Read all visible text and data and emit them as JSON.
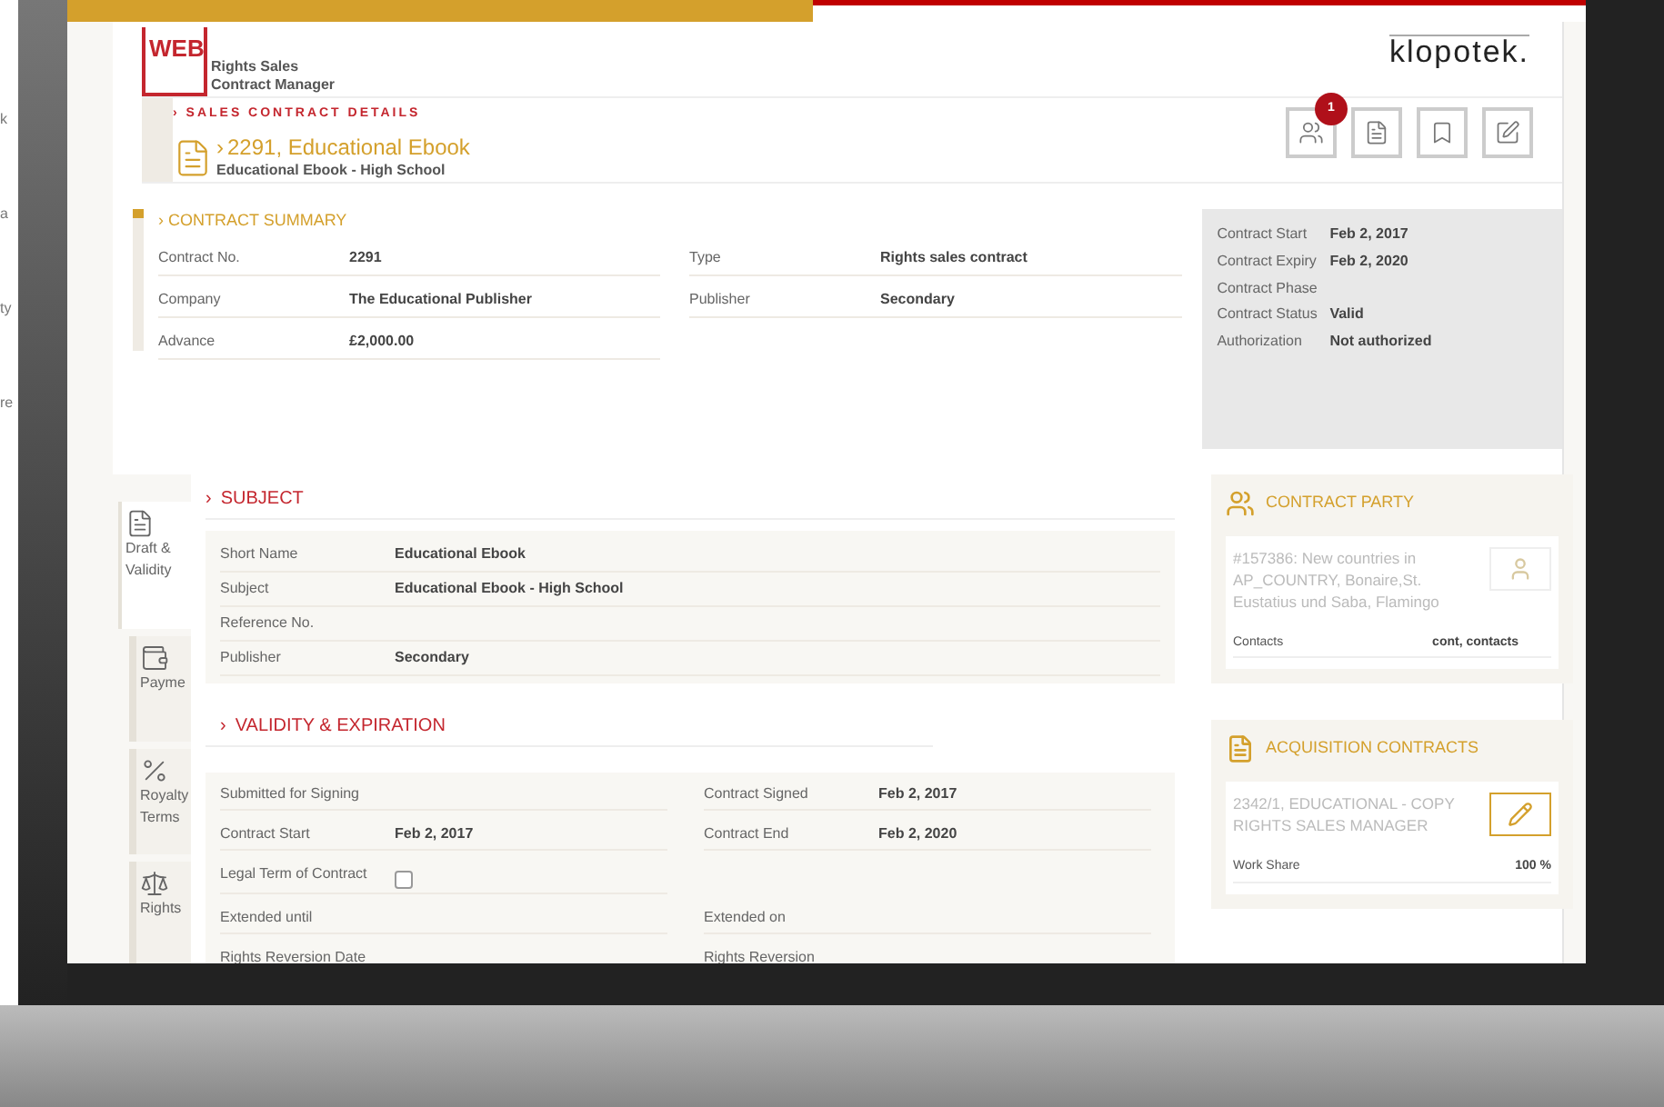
{
  "background_window": {
    "fragments": [
      "k",
      "a",
      "ty",
      "re"
    ]
  },
  "header": {
    "logo_mark": "WEB",
    "logo_lines": [
      "Rights Sales",
      "Contract Manager"
    ],
    "brand": "klopotek."
  },
  "details": {
    "section_label": "› SALES CONTRACT DETAILS",
    "chevron": "›",
    "title": "2291, Educational Ebook",
    "subtitle": "Educational Ebook - High School",
    "toolbar": [
      {
        "kind": "people",
        "badge": "1"
      },
      {
        "kind": "sign"
      },
      {
        "kind": "bookmark"
      },
      {
        "kind": "edit"
      }
    ]
  },
  "summary": {
    "heading": "› CONTRACT SUMMARY",
    "left": [
      {
        "label": "Contract No.",
        "value": "2291"
      },
      {
        "label": "Company",
        "value": "The Educational Publisher"
      },
      {
        "label": "Advance",
        "value": "£2,000.00"
      }
    ],
    "right": [
      {
        "label": "Type",
        "value": "Rights sales contract"
      },
      {
        "label": "Publisher",
        "value": "Secondary"
      }
    ]
  },
  "status_panel": [
    {
      "label": "Contract Start",
      "value": "Feb 2, 2017"
    },
    {
      "label": "Contract Expiry",
      "value": "Feb 2, 2020"
    },
    {
      "label": "Contract Phase"
    },
    {
      "label": "Contract Status",
      "value": "Valid"
    },
    {
      "label": "Authorization",
      "value": "Not authorized"
    }
  ],
  "tabs": [
    {
      "kind": "draft",
      "label": "Draft & Validity",
      "selected": true
    },
    {
      "kind": "payment",
      "label": "Payme",
      "selected": false
    },
    {
      "kind": "royalty",
      "label": "Royalty Terms",
      "selected": false
    },
    {
      "kind": "rights",
      "label": "Rights",
      "selected": false
    }
  ],
  "subject": {
    "heading": "SUBJECT",
    "chevron": "›",
    "fields": [
      {
        "label": "Short Name",
        "value": "Educational Ebook"
      },
      {
        "label": "Subject",
        "value": "Educational Ebook - High School"
      },
      {
        "label": "Reference No."
      },
      {
        "label": "Publisher",
        "value": "Secondary"
      }
    ]
  },
  "validity": {
    "heading": "VALIDITY & EXPIRATION",
    "chevron": "›",
    "rows": [
      [
        {
          "kind": "text",
          "label": "Submitted for Signing"
        },
        {
          "kind": "text",
          "label": "Contract Signed",
          "value": "Feb 2, 2017"
        }
      ],
      [
        {
          "kind": "text",
          "label": "Contract Start",
          "value": "Feb 2, 2017"
        },
        {
          "kind": "text",
          "label": "Contract End",
          "value": "Feb 2, 2020"
        }
      ],
      [
        {
          "kind": "checkbox",
          "label": "Legal Term of Contract",
          "checked": false
        }
      ],
      [
        {
          "kind": "text",
          "label": "Extended until"
        },
        {
          "kind": "text",
          "label": "Extended on"
        }
      ],
      [
        {
          "kind": "text",
          "label": "Rights Reversion Date"
        },
        {
          "kind": "text",
          "label": "Rights Reversion"
        }
      ]
    ]
  },
  "contract_party": {
    "title": "CONTRACT PARTY",
    "text": "#157386: New countries in AP_COUNTRY, Bonaire,St. Eustatius und Saba, Flamingo",
    "label": "Contacts",
    "value": "cont, contacts"
  },
  "acquisition_contracts": {
    "title": "ACQUISITION CONTRACTS",
    "text": "2342/1, EDUCATIONAL - COPY RIGHTS SALES MANAGER",
    "label": "Work Share",
    "value": "100 %"
  }
}
